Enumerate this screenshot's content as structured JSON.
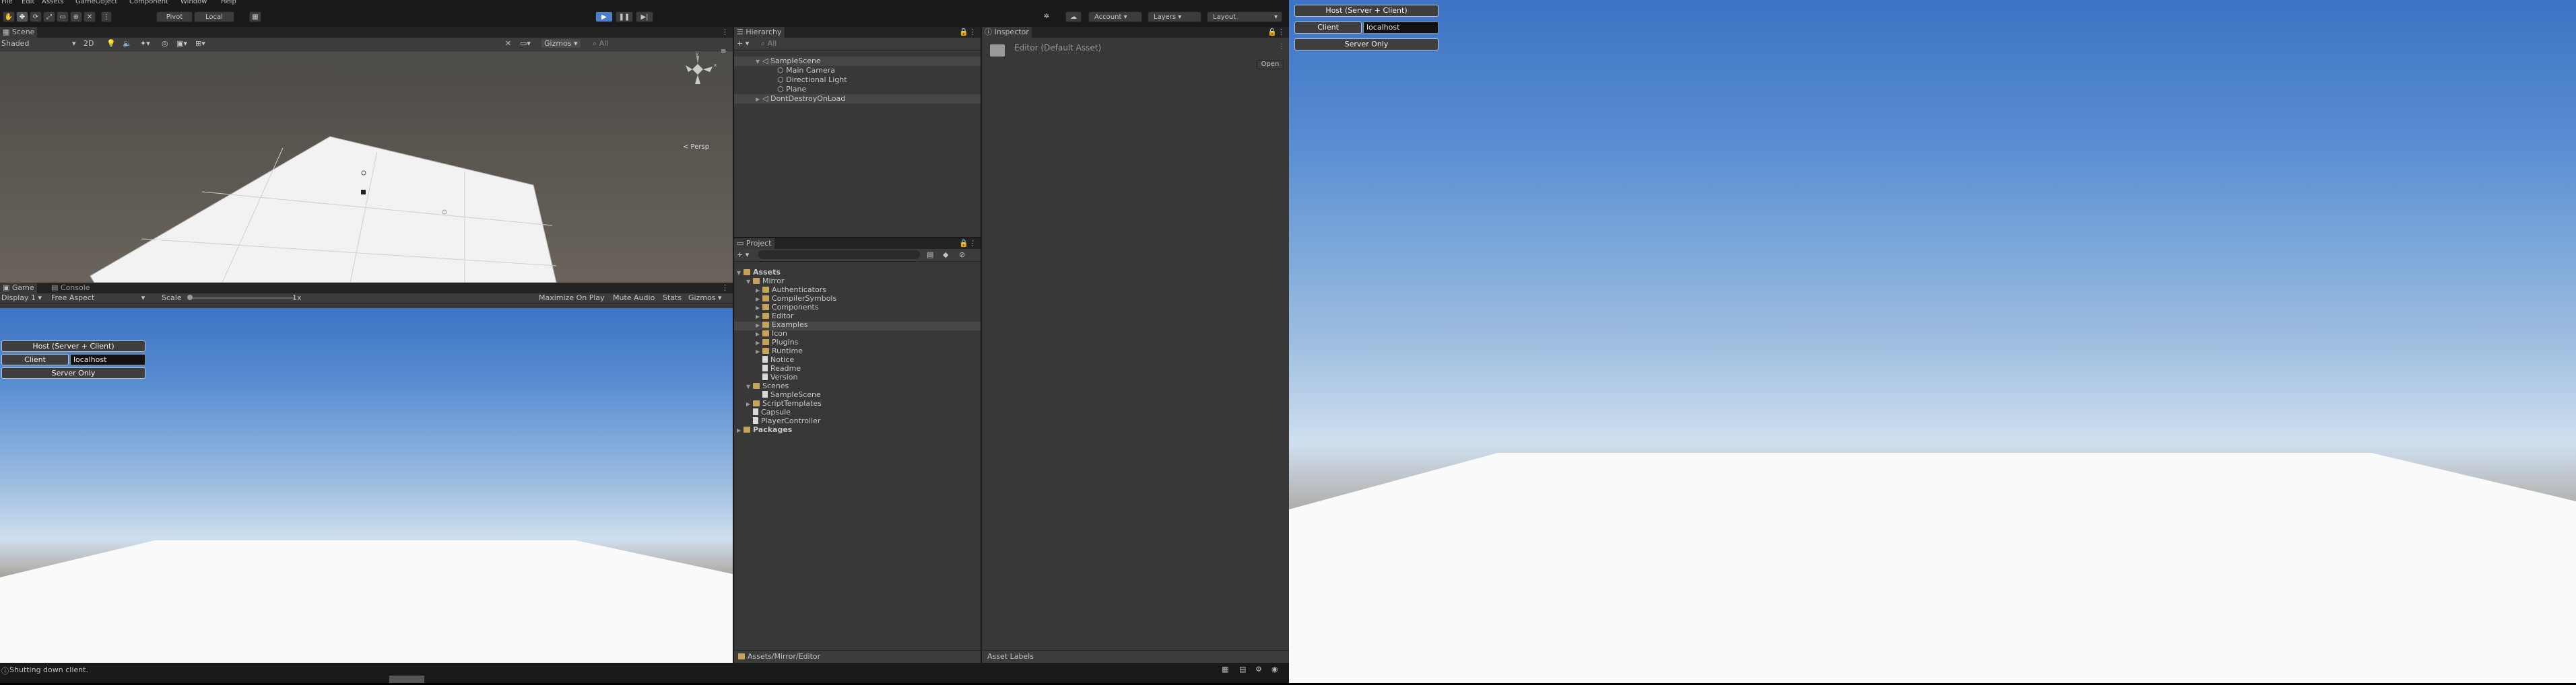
{
  "menu": [
    "File",
    "Edit",
    "Assets",
    "GameObject",
    "Component",
    "Window",
    "Help"
  ],
  "toolbar": {
    "pivot": "Pivot",
    "local": "Local",
    "account": "Account",
    "layers": "Layers",
    "layout": "Layout"
  },
  "scene": {
    "tab": "Scene",
    "shading": "Shaded",
    "gizmos": "Gizmos",
    "search_placeholder": "All",
    "persp": "< Persp"
  },
  "game": {
    "tab_game": "Game",
    "tab_console": "Console",
    "display": "Display 1",
    "aspect": "Free Aspect",
    "scale_label": "Scale",
    "scale_value": "1x",
    "maximize": "Maximize On Play",
    "mute": "Mute Audio",
    "stats": "Stats",
    "gizmos": "Gizmos"
  },
  "netgui": {
    "host": "Host (Server + Client)",
    "client": "Client",
    "address": "localhost",
    "server": "Server Only"
  },
  "hierarchy": {
    "tab": "Hierarchy",
    "search_placeholder": "All",
    "items": [
      {
        "label": "SampleScene"
      },
      {
        "label": "Main Camera"
      },
      {
        "label": "Directional Light"
      },
      {
        "label": "Plane"
      },
      {
        "label": "DontDestroyOnLoad"
      }
    ]
  },
  "project": {
    "tab": "Project",
    "path": "Assets/Mirror/Editor",
    "items": [
      {
        "label": "Assets",
        "kind": "folder"
      },
      {
        "label": "Mirror",
        "kind": "folder"
      },
      {
        "label": "Authenticators",
        "kind": "folder"
      },
      {
        "label": "CompilerSymbols",
        "kind": "folder"
      },
      {
        "label": "Components",
        "kind": "folder"
      },
      {
        "label": "Editor",
        "kind": "folder"
      },
      {
        "label": "Examples",
        "kind": "folder"
      },
      {
        "label": "Icon",
        "kind": "folder"
      },
      {
        "label": "Plugins",
        "kind": "folder"
      },
      {
        "label": "Runtime",
        "kind": "folder"
      },
      {
        "label": "Notice",
        "kind": "file"
      },
      {
        "label": "Readme",
        "kind": "file"
      },
      {
        "label": "Version",
        "kind": "file"
      },
      {
        "label": "Scenes",
        "kind": "folder"
      },
      {
        "label": "SampleScene",
        "kind": "file"
      },
      {
        "label": "ScriptTemplates",
        "kind": "folder"
      },
      {
        "label": "Capsule",
        "kind": "file"
      },
      {
        "label": "PlayerController",
        "kind": "file"
      },
      {
        "label": "Packages",
        "kind": "folder"
      }
    ]
  },
  "inspector": {
    "tab": "Inspector",
    "title": "Editor (Default Asset)",
    "open": "Open",
    "asset_labels": "Asset Labels"
  },
  "status": {
    "message": "Shutting down client."
  },
  "colors": {
    "accent": "#4d7fc8",
    "selection": "#2c5d87",
    "panel": "#383838"
  }
}
